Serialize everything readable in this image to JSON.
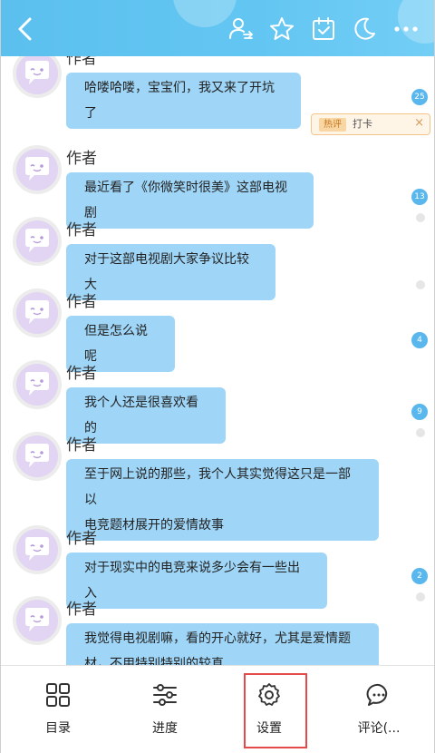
{
  "messages": [
    {
      "author": "作者",
      "text": "哈喽哈喽，宝宝们，我又来了开坑了"
    },
    {
      "author": "作者",
      "text": "最近看了《你微笑时很美》这部电视剧"
    },
    {
      "author": "作者",
      "text": "对于这部电视剧大家争议比较大"
    },
    {
      "author": "作者",
      "text": "但是怎么说呢"
    },
    {
      "author": "作者",
      "text": "我个人还是很喜欢看的"
    },
    {
      "author": "作者",
      "text_line1": "至于网上说的那些，我个人其实觉得这只是一部以",
      "text_line2": "电竞题材展开的爱情故事"
    },
    {
      "author": "作者",
      "text": "对于现实中的电竞来说多少会有一些出入"
    },
    {
      "author": "作者",
      "text_line1": "我觉得电视剧嘛，看的开心就好，尤其是爱情题",
      "text_line2": "材，不用特别特别的较真"
    }
  ],
  "comment_counts": [
    "25",
    "13",
    "4",
    "9",
    "2"
  ],
  "tag_card": {
    "tag": "热评",
    "text": "打卡",
    "close": "×"
  },
  "header_icons": [
    "back-icon",
    "author-switch-icon",
    "star-icon",
    "calendar-check-icon",
    "moon-icon",
    "more-icon"
  ],
  "bottom_tabs": [
    {
      "label": "目录",
      "icon": "grid-icon"
    },
    {
      "label": "进度",
      "icon": "sliders-icon"
    },
    {
      "label": "设置",
      "icon": "gear-icon"
    },
    {
      "label": "评论(...",
      "icon": "comment-icon"
    }
  ],
  "colors": {
    "header": "#5cc0ef",
    "bubble": "#9fd6f8",
    "badge": "#5ab7ee",
    "highlight": "#e44a4a"
  }
}
